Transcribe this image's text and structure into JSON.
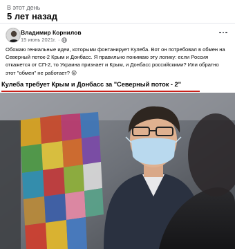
{
  "memory": {
    "label": "В этот день",
    "title": "5 лет назад"
  },
  "post": {
    "author": "Владимир Корнилов",
    "date": "15 июнь 2021г.",
    "privacy_icon": "globe-icon",
    "menu_icon": "more-dots-icon",
    "text_lines": [
      "Обожаю гениальные идеи, которыми фонтанирует Кулеба. Вот он потребовал в обмен на",
      "Северный поток-2 Крым и Донбасс. Я правильно понимаю эту логику: если Россия",
      "откажется от СП-2, то Украина признает и Крым, и Донбасс российскими? Или обратно",
      "этот \"обмен\" не работает? 😜"
    ]
  },
  "shared": {
    "headline": "Кулеба требует Крым и Донбасс за \"Северный поток - 2\"",
    "accent_color": "#c8211a"
  }
}
